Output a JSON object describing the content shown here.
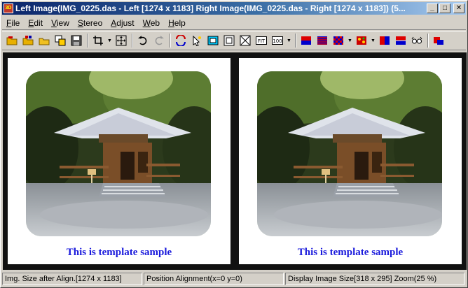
{
  "window": {
    "title": "Left Image(IMG_0225.das - Left [1274 x 1183] Right Image(IMG_0225.das - Right [1274 x 1183])  (5...",
    "app_icon": "3D",
    "buttons": {
      "minimize": "_",
      "maximize": "□",
      "close": "✕"
    }
  },
  "menu": [
    {
      "first": "F",
      "rest": "ile"
    },
    {
      "first": "E",
      "rest": "dit"
    },
    {
      "first": "V",
      "rest": "iew"
    },
    {
      "first": "S",
      "rest": "tereo"
    },
    {
      "first": "A",
      "rest": "djust"
    },
    {
      "first": "W",
      "rest": "eb"
    },
    {
      "first": "H",
      "rest": "elp"
    }
  ],
  "toolbar": {
    "icons": [
      "open-folder-icon",
      "open-pair-icon",
      "open-file-icon",
      "copy-window-icon",
      "save-icon",
      "crop-icon",
      "move-icon",
      "undo-icon",
      "redo-icon",
      "swap-icon",
      "auto-align-icon",
      "fit-frame-icon",
      "window-frame-icon",
      "full-frame-icon",
      "fit-icon",
      "actual-size-icon",
      "anaglyph-red-blue-icon",
      "interlace-icon",
      "checkerboard-icon",
      "mosaic-icon",
      "side-by-side-icon",
      "overlap-icon",
      "view-glasses-icon",
      "color-stereo-icon"
    ],
    "fit_label": "FIT",
    "actual_label": "100"
  },
  "panels": {
    "left": {
      "caption": "This is template sample"
    },
    "right": {
      "caption": "This is template sample"
    }
  },
  "status": {
    "size_after_align": "Img. Size after Align.[1274 x 1183]",
    "position_alignment": "Position Alignment(x=0 y=0)",
    "display_size": "Display Image Size[318 x 295]  Zoom(25 %)"
  },
  "colors": {
    "title_gradient_start": "#0a246a",
    "caption_blue": "#1a1adc",
    "work_background": "#111111"
  }
}
